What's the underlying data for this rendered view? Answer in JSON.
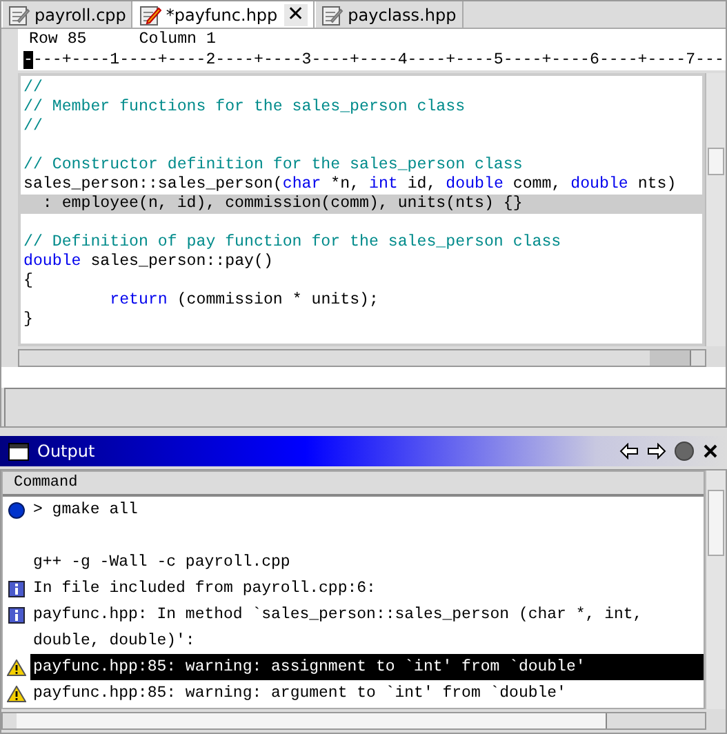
{
  "tabs": [
    {
      "label": "payroll.cpp",
      "selected": false,
      "modified": false
    },
    {
      "label": "*payfunc.hpp",
      "selected": true,
      "modified": true,
      "close": "✕"
    },
    {
      "label": "payclass.hpp",
      "selected": false,
      "modified": false
    }
  ],
  "position": {
    "row": "Row 85",
    "column": "Column 1"
  },
  "ruler": "----+----1----+----2----+----3----+----4----+----5----+----6----+----7---",
  "code_lines": [
    {
      "selected": false,
      "tokens": [
        {
          "kind": "comment",
          "text": "//"
        }
      ]
    },
    {
      "selected": false,
      "tokens": [
        {
          "kind": "comment",
          "text": "// Member functions for the sales_person class"
        }
      ]
    },
    {
      "selected": false,
      "tokens": [
        {
          "kind": "comment",
          "text": "//"
        }
      ]
    },
    {
      "selected": false
    },
    {
      "selected": false,
      "tokens": [
        {
          "kind": "comment",
          "text": "// Constructor definition for the sales_person class"
        }
      ]
    },
    {
      "selected": false,
      "tokens": [
        {
          "kind": "plain",
          "text": "sales_person::sales_person("
        },
        {
          "kind": "keyword",
          "text": "char"
        },
        {
          "kind": "plain",
          "text": " *n, "
        },
        {
          "kind": "keyword",
          "text": "int"
        },
        {
          "kind": "plain",
          "text": " id, "
        },
        {
          "kind": "keyword",
          "text": "double"
        },
        {
          "kind": "plain",
          "text": " comm, "
        },
        {
          "kind": "keyword",
          "text": "double"
        },
        {
          "kind": "plain",
          "text": " nts)"
        }
      ]
    },
    {
      "selected": true,
      "tokens": [
        {
          "kind": "plain",
          "text": "  : employee(n, id), commission(comm), units(nts) {}"
        }
      ]
    },
    {
      "selected": false
    },
    {
      "selected": false,
      "tokens": [
        {
          "kind": "comment",
          "text": "// Definition of pay function for the sales_person class"
        }
      ]
    },
    {
      "selected": false,
      "tokens": [
        {
          "kind": "keyword",
          "text": "double"
        },
        {
          "kind": "plain",
          "text": " sales_person::pay()"
        }
      ]
    },
    {
      "selected": false,
      "tokens": [
        {
          "kind": "plain",
          "text": "{"
        }
      ]
    },
    {
      "selected": false,
      "tokens": [
        {
          "kind": "keyword",
          "text": "         return"
        },
        {
          "kind": "plain",
          "text": " (commission * units);"
        }
      ]
    },
    {
      "selected": false,
      "tokens": [
        {
          "kind": "plain",
          "text": "}"
        }
      ]
    }
  ],
  "output": {
    "title": "Output",
    "column": "Command",
    "rows": [
      {
        "kind": "status",
        "text": "> gmake all",
        "selected": false
      },
      {
        "kind": "blank"
      },
      {
        "kind": "plain",
        "text": "g++ -g -Wall -c payroll.cpp",
        "selected": false
      },
      {
        "kind": "info",
        "text": "In file included from payroll.cpp:6:",
        "selected": false
      },
      {
        "kind": "info",
        "text": "payfunc.hpp: In method `sales_person::sales_person (char *, int, double, double)':",
        "selected": false
      },
      {
        "kind": "warning",
        "text": "payfunc.hpp:85: warning: assignment to `int' from `double'",
        "selected": true
      },
      {
        "kind": "warning",
        "text": "payfunc.hpp:85: warning: argument to `int' from `double'",
        "selected": false
      }
    ]
  }
}
